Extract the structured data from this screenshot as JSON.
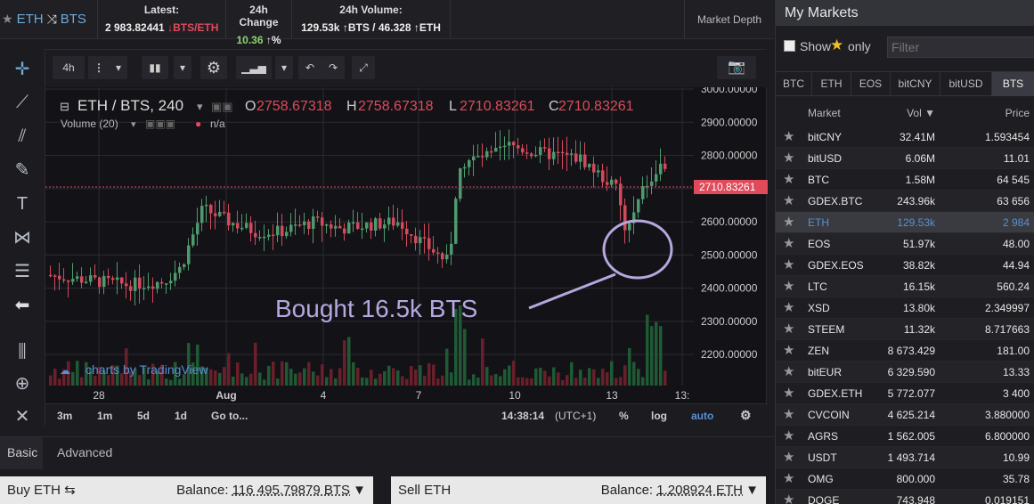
{
  "header": {
    "pair_base": "ETH",
    "pair_quote": "BTS",
    "latest_label": "Latest:",
    "latest_value": "2 983.82441",
    "latest_unit": "↓BTS/ETH",
    "change_label": "24h Change",
    "change_value": "10.36",
    "change_unit": "↑%",
    "volume_label": "24h Volume:",
    "volume_value_a": "129.53k",
    "volume_value_b": "↑BTS / 46.328",
    "volume_value_c": "↑ETH",
    "market_depth": "Market Depth"
  },
  "chart_toolbar": {
    "interval": "4h",
    "more": "⋮"
  },
  "chart": {
    "legend_title": "ETH / BTS, 240",
    "o_label": "O",
    "o_value": "2758.67318",
    "h_label": "H",
    "h_value": "2758.67318",
    "l_label": "L",
    "l_value": "2710.83261",
    "c_label": "C",
    "c_value": "2710.83261",
    "volume_label": "Volume (20)",
    "volume_value": "n/a",
    "annotation": "Bought 16.5k BTS",
    "watermark": "charts by TradingView",
    "last_price_tag": "2710.83261"
  },
  "chart_bottom": {
    "r3m": "3m",
    "r1m": "1m",
    "r5d": "5d",
    "r1d": "1d",
    "goto": "Go to...",
    "time": "14:38:14",
    "tz": "(UTC+1)",
    "pct": "%",
    "log": "log",
    "auto": "auto"
  },
  "chart_data": {
    "type": "candlestick",
    "y_axis_ticks": [
      "3000.00000",
      "2900.00000",
      "2800.00000",
      "2700.00000",
      "2600.00000",
      "2500.00000",
      "2400.00000",
      "2300.00000",
      "2200.00000"
    ],
    "x_axis_ticks": [
      "28",
      "Aug",
      "4",
      "7",
      "10",
      "13",
      "13:"
    ],
    "ylim": [
      2100,
      3000
    ],
    "last_price": 2710.83261,
    "volume_series": "Volume (20)"
  },
  "mode_tabs": {
    "basic": "Basic",
    "advanced": "Advanced"
  },
  "buy": {
    "label": "Buy ETH ⇆",
    "balance_label": "Balance:",
    "balance_value": "116 495.79879 BTS"
  },
  "sell": {
    "label": "Sell ETH",
    "balance_label": "Balance:",
    "balance_value": "1.208924 ETH"
  },
  "markets": {
    "title": "My Markets",
    "show_label": "Show",
    "only_label": "only",
    "filter_placeholder": "Filter",
    "tabs": [
      "BTC",
      "ETH",
      "EOS",
      "bitCNY",
      "bitUSD",
      "BTS"
    ],
    "col_market": "Market",
    "col_vol": "Vol ▼",
    "col_price": "Price",
    "rows": [
      {
        "name": "bitCNY",
        "vol": "32.41M",
        "price": "1.593454"
      },
      {
        "name": "bitUSD",
        "vol": "6.06M",
        "price": "11.01"
      },
      {
        "name": "BTC",
        "vol": "1.58M",
        "price": "64 545"
      },
      {
        "name": "GDEX.BTC",
        "vol": "243.96k",
        "price": "63 656"
      },
      {
        "name": "ETH",
        "vol": "129.53k",
        "price": "2 984"
      },
      {
        "name": "EOS",
        "vol": "51.97k",
        "price": "48.00"
      },
      {
        "name": "GDEX.EOS",
        "vol": "38.82k",
        "price": "44.94"
      },
      {
        "name": "LTC",
        "vol": "16.15k",
        "price": "560.24"
      },
      {
        "name": "XSD",
        "vol": "13.80k",
        "price": "2.349997"
      },
      {
        "name": "STEEM",
        "vol": "11.32k",
        "price": "8.717663"
      },
      {
        "name": "ZEN",
        "vol": "8 673.429",
        "price": "181.00"
      },
      {
        "name": "bitEUR",
        "vol": "6 329.590",
        "price": "13.33"
      },
      {
        "name": "GDEX.ETH",
        "vol": "5 772.077",
        "price": "3 400"
      },
      {
        "name": "CVCOIN",
        "vol": "4 625.214",
        "price": "3.880000"
      },
      {
        "name": "AGRS",
        "vol": "1 562.005",
        "price": "6.800000"
      },
      {
        "name": "USDT",
        "vol": "1 493.714",
        "price": "10.99"
      },
      {
        "name": "OMG",
        "vol": "800.000",
        "price": "35.78"
      },
      {
        "name": "DOGE",
        "vol": "743.948",
        "price": "0.019151"
      }
    ]
  }
}
